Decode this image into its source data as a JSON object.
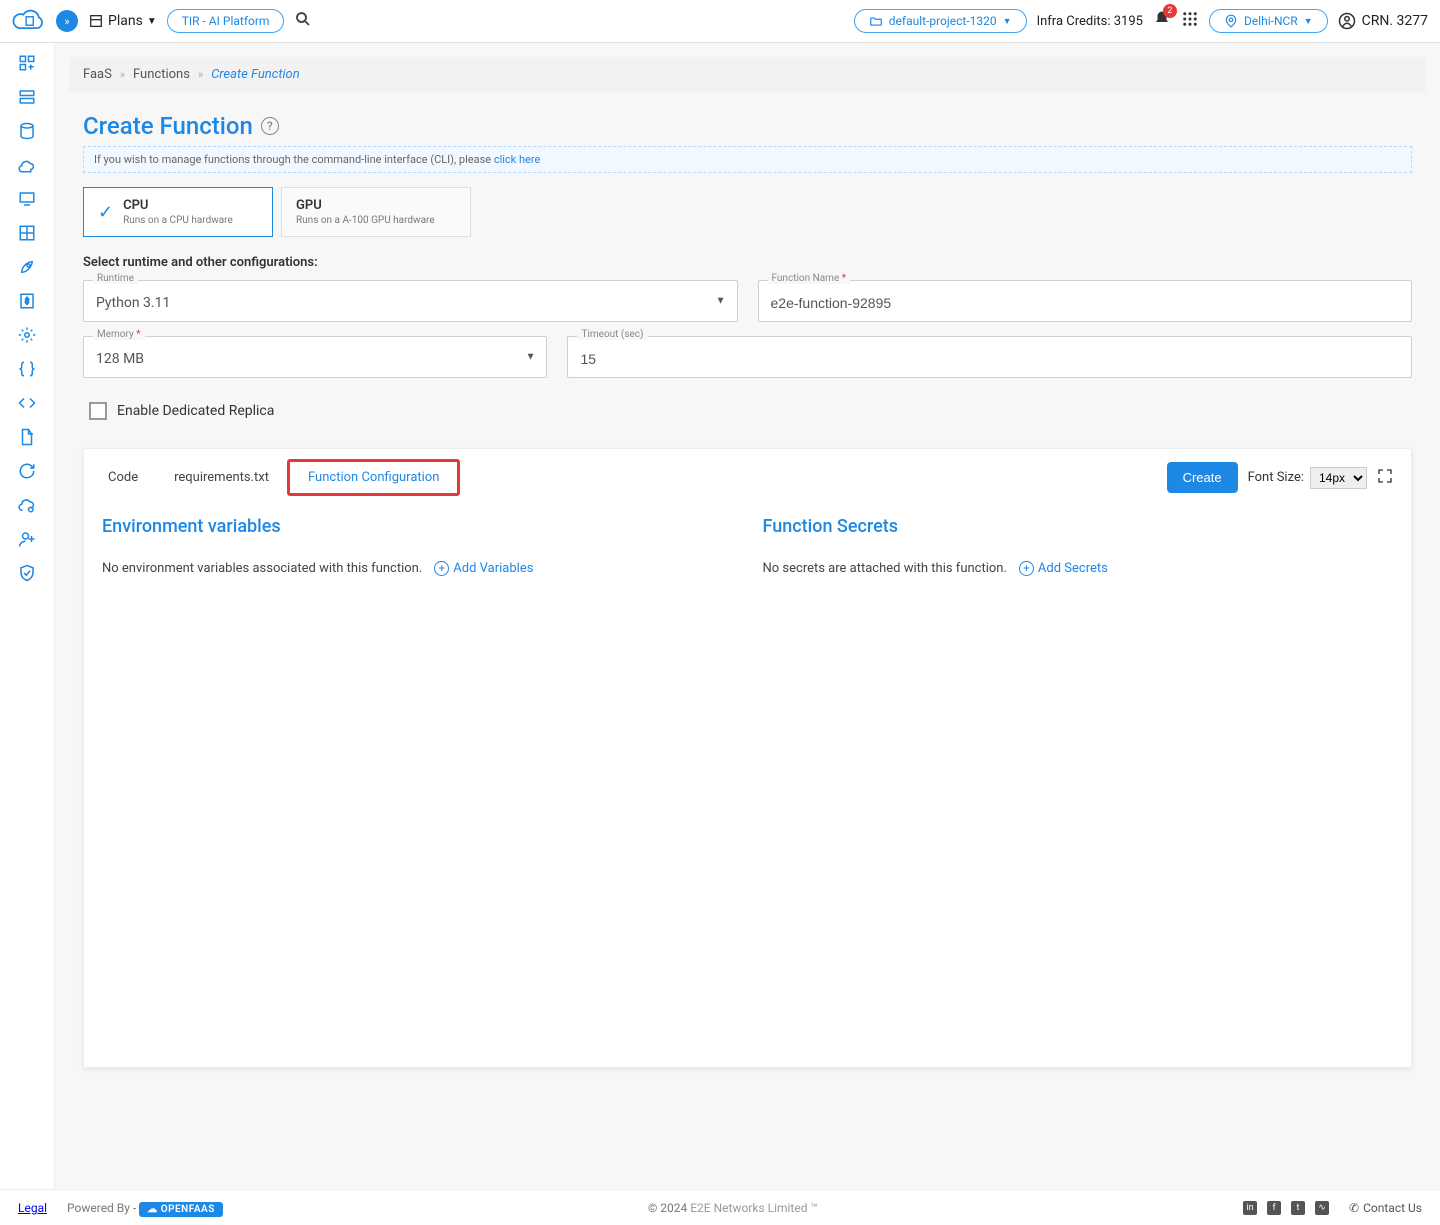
{
  "topbar": {
    "plans_label": "Plans",
    "tir_label": "TIR - AI Platform",
    "project_label": "default-project-1320",
    "credits_label": "Infra Credits: 3195",
    "notif_count": "2",
    "region_label": "Delhi-NCR",
    "crn_label": "CRN. 3277"
  },
  "breadcrumb": {
    "root": "FaaS",
    "mid": "Functions",
    "current": "Create Function"
  },
  "page": {
    "title": "Create Function",
    "info_text": "If you wish to manage functions through the command-line interface (CLI), please ",
    "info_link": "click here"
  },
  "hardware": {
    "cpu_title": "CPU",
    "cpu_desc": "Runs on a CPU hardware",
    "gpu_title": "GPU",
    "gpu_desc": "Runs on a A-100 GPU hardware"
  },
  "section_label": "Select runtime and other configurations:",
  "form": {
    "runtime_label": "Runtime",
    "runtime_value": "Python 3.11",
    "fname_label": "Function Name",
    "fname_value": "e2e-function-92895",
    "memory_label": "Memory",
    "memory_value": "128 MB",
    "timeout_label": "Timeout (sec)",
    "timeout_value": "15",
    "replica_label": "Enable Dedicated Replica"
  },
  "tabs": {
    "code": "Code",
    "req": "requirements.txt",
    "config": "Function Configuration",
    "create_btn": "Create",
    "font_size_label": "Font Size:",
    "font_size_value": "14px"
  },
  "config": {
    "env_title": "Environment variables",
    "env_empty": "No environment variables associated with this function.",
    "env_add": "Add Variables",
    "secrets_title": "Function Secrets",
    "secrets_empty": "No secrets are attached with this function.",
    "secrets_add": "Add Secrets"
  },
  "footer": {
    "legal": "Legal",
    "powered": "Powered By -",
    "openfaas": "☁ OPENFAAS",
    "copyright": "© 2024 ",
    "company": "E2E Networks Limited ™",
    "contact": "Contact Us"
  }
}
